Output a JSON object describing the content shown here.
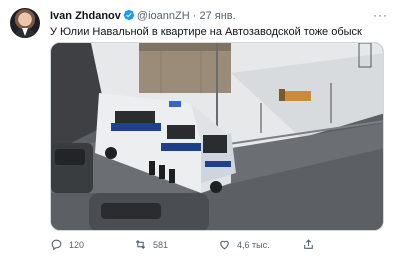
{
  "tweet": {
    "author_name": "Ivan Zhdanov",
    "handle": "@ioannZH",
    "separator": "·",
    "date": "27 янв.",
    "more_label": "···",
    "text": "У Юлии Навальной в квартире на Автозаводской тоже обыск"
  },
  "media": {
    "icon": "video-frame-image"
  },
  "actions": {
    "reply_count": "120",
    "retweet_count": "581",
    "like_count": "4,6 тыс.",
    "share_label": ""
  },
  "colors": {
    "verified": "#1d9bf0",
    "text": "#0f1419",
    "muted": "#536471"
  }
}
